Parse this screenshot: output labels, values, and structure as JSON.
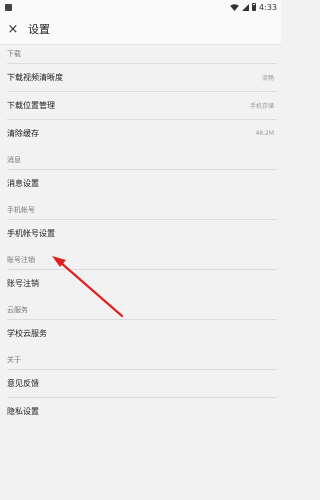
{
  "status_bar": {
    "time": "4:33",
    "icons": [
      "notification-icon",
      "wifi-icon",
      "signal-icon",
      "battery-icon"
    ]
  },
  "toolbar": {
    "close_icon": "×",
    "title": "设置"
  },
  "sections": {
    "download": {
      "header": "下载",
      "items": [
        {
          "label": "下载视频清晰度",
          "value": "流畅"
        },
        {
          "label": "下载位置管理",
          "value": "手机存储"
        },
        {
          "label": "清除缓存",
          "value": "48.2M"
        }
      ]
    },
    "message": {
      "header": "消息",
      "items": [
        {
          "label": "消息设置"
        }
      ]
    },
    "phone_account": {
      "header": "手机帐号",
      "items": [
        {
          "label": "手机帐号设置"
        }
      ]
    },
    "account_cancel": {
      "header": "账号注销",
      "items": [
        {
          "label": "账号注销"
        }
      ]
    },
    "cloud": {
      "header": "云服务",
      "items": [
        {
          "label": "学校云服务"
        }
      ]
    },
    "about": {
      "header": "关于",
      "items": [
        {
          "label": "意见反馈"
        },
        {
          "label": "隐私设置"
        }
      ]
    }
  },
  "colors": {
    "annotation_arrow": "#e02020",
    "background": "#f2f2f2",
    "divider": "#dcdcdc"
  }
}
